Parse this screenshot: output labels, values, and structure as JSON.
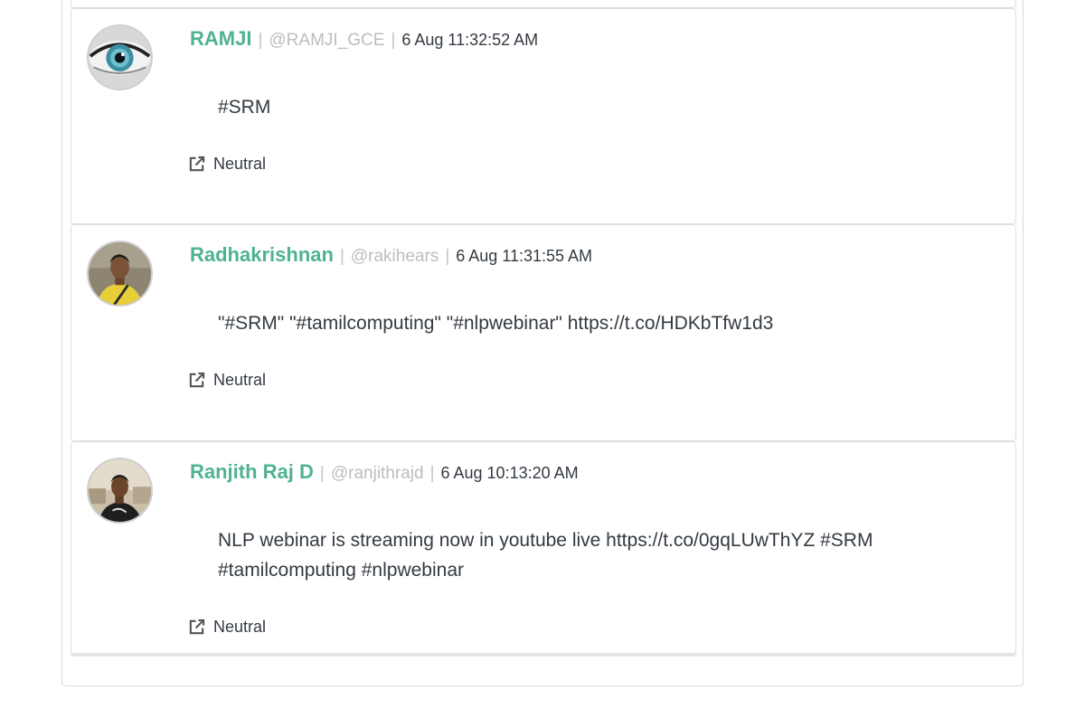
{
  "tweets": [
    {
      "name": "RAMJI",
      "handle": "@RAMJI_GCE",
      "time": "6 Aug 11:32:52 AM",
      "text": "#SRM",
      "sentiment": "Neutral",
      "avatar_icon": "eye-avatar"
    },
    {
      "name": "Radhakrishnan",
      "handle": "@rakihears",
      "time": "6 Aug 11:31:55 AM",
      "text": "\"#SRM\" \"#tamilcomputing\" \"#nlpwebinar\" https://t.co/HDKbTfw1d3",
      "sentiment": "Neutral",
      "avatar_icon": "person-yellow-shirt-avatar"
    },
    {
      "name": "Ranjith Raj D",
      "handle": "@ranjithrajd",
      "time": "6 Aug 10:13:20 AM",
      "text": "NLP webinar is streaming now in youtube live https://t.co/0gqLUwThYZ #SRM #tamilcomputing #nlpwebinar",
      "sentiment": "Neutral",
      "avatar_icon": "person-outdoor-avatar"
    }
  ],
  "separator": "|",
  "colors": {
    "user_name": "#4fb38f",
    "handle": "#bdbdbd",
    "text": "#333a42",
    "border": "#dedede"
  },
  "icons": {
    "sentiment": "external-link-icon"
  }
}
